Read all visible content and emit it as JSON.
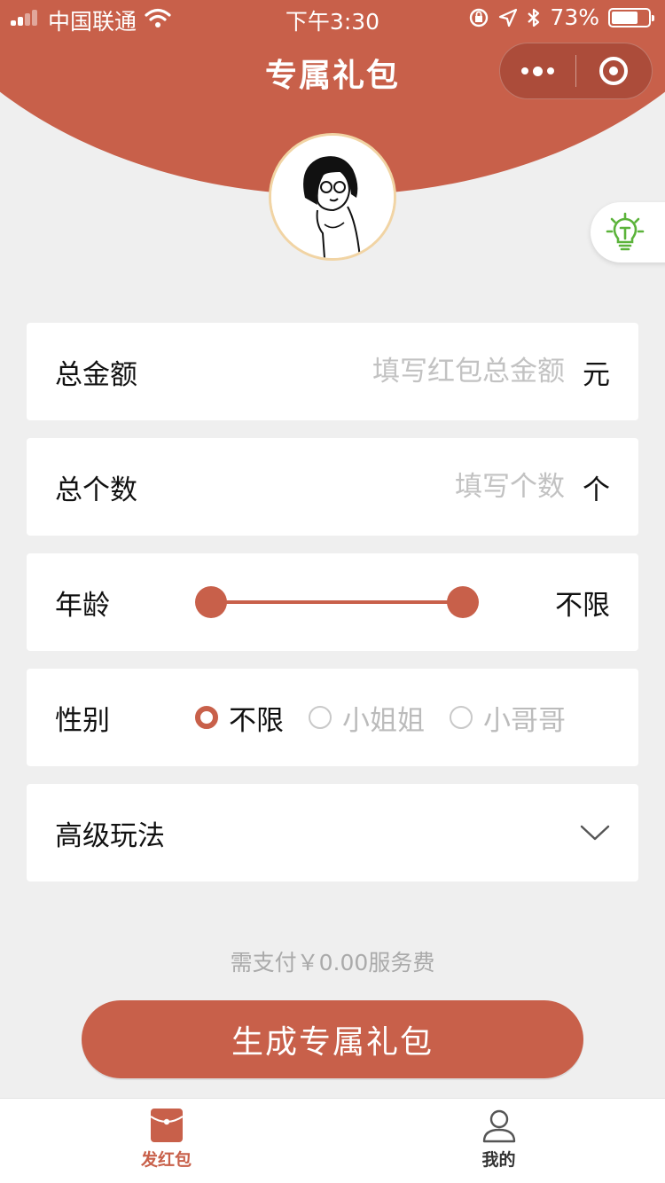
{
  "status_bar": {
    "carrier": "中国联通",
    "time": "下午3:30",
    "battery_text": "73%",
    "battery_level": 0.73
  },
  "nav": {
    "title": "专属礼包"
  },
  "form": {
    "amount": {
      "label": "总金额",
      "placeholder": "填写红包总金额",
      "unit": "元"
    },
    "count": {
      "label": "总个数",
      "placeholder": "填写个数",
      "unit": "个"
    },
    "age": {
      "label": "年龄",
      "value": "不限"
    },
    "gender": {
      "label": "性别",
      "options": [
        "不限",
        "小姐姐",
        "小哥哥"
      ],
      "selected": "不限"
    },
    "advanced": {
      "label": "高级玩法"
    }
  },
  "fee_text": "需支付￥0.00服务费",
  "submit_label": "生成专属礼包",
  "tabbar": {
    "items": [
      {
        "label": "发红包",
        "icon": "red-envelope-icon",
        "active": true
      },
      {
        "label": "我的",
        "icon": "user-icon",
        "active": false
      }
    ]
  },
  "colors": {
    "accent": "#c8604a",
    "background": "#efefef",
    "tip_green": "#5bb33a"
  }
}
